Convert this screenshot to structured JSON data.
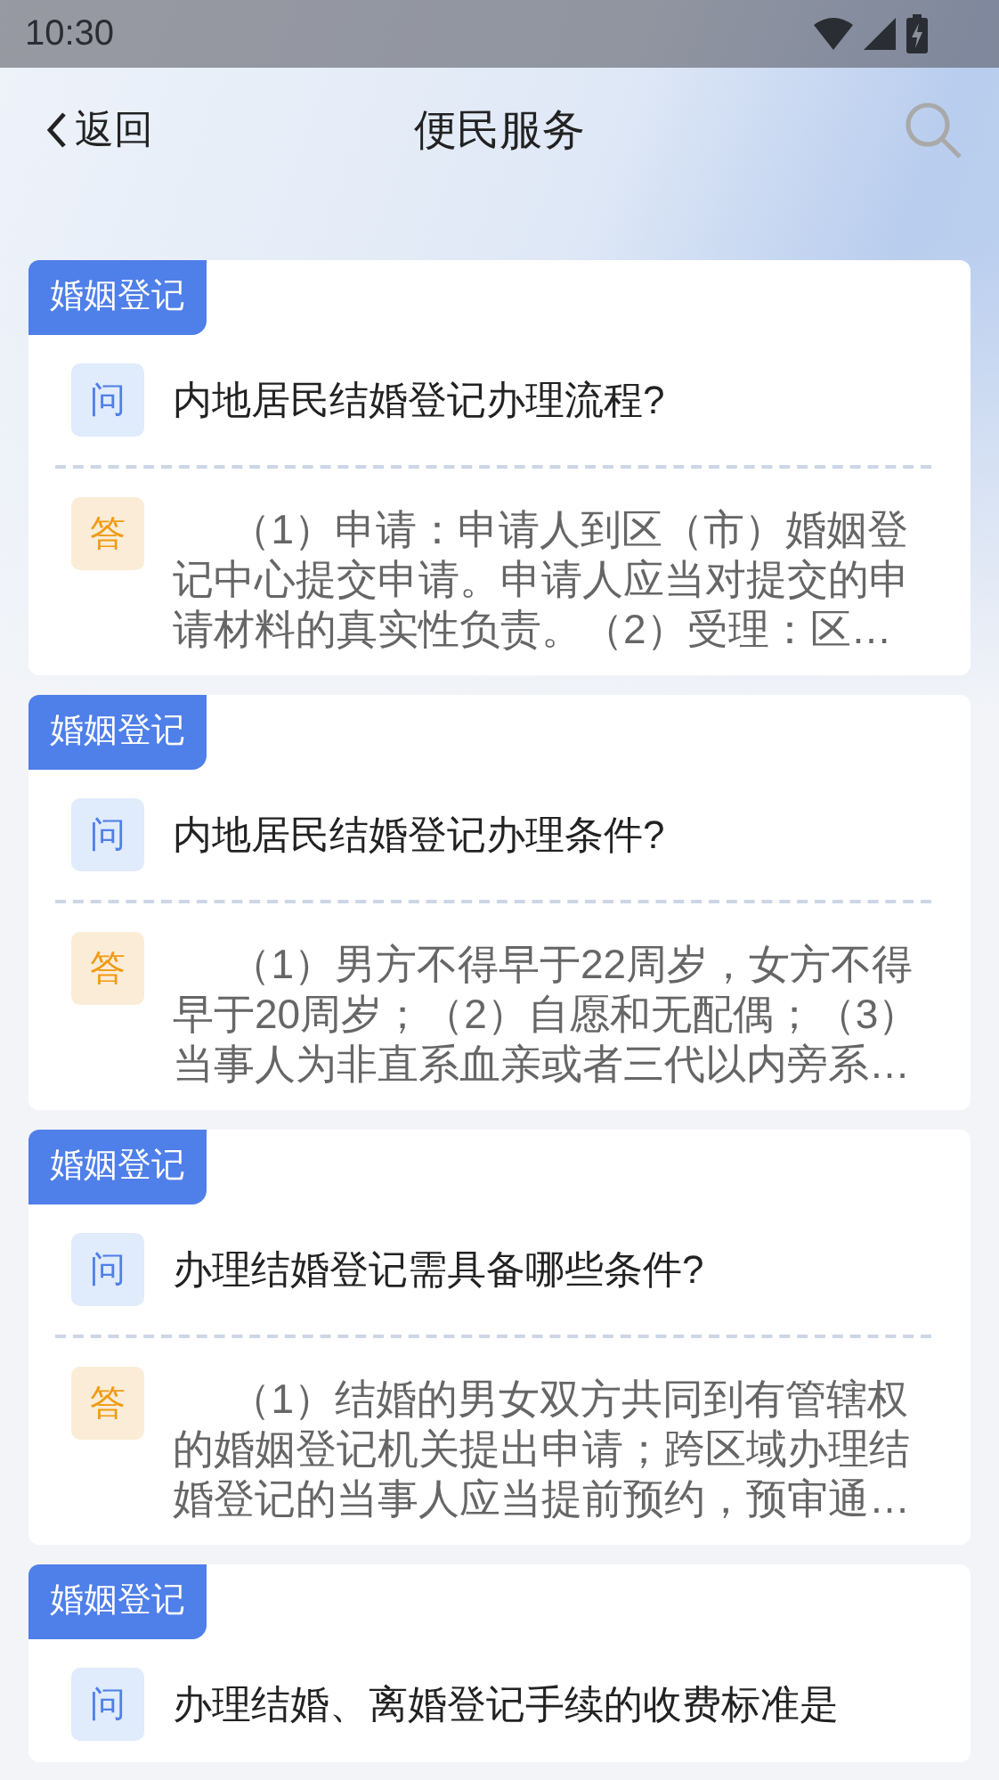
{
  "status_bar": {
    "time": "10:30"
  },
  "header": {
    "back_label": "返回",
    "title": "便民服务"
  },
  "items": [
    {
      "tag": "婚姻登记",
      "question_badge": "问",
      "question": "内地居民结婚登记办理流程?",
      "answer_badge": "答",
      "answer": "（1）申请：申请人到区（市）婚姻登记中心提交申请。申请人应当对提交的申请材料的真实性负责。（2）受理：区…"
    },
    {
      "tag": "婚姻登记",
      "question_badge": "问",
      "question": "内地居民结婚登记办理条件?",
      "answer_badge": "答",
      "answer": "（1）男方不得早于22周岁，女方不得早于20周岁；（2）自愿和无配偶；（3）当事人为非直系血亲或者三代以内旁系…"
    },
    {
      "tag": "婚姻登记",
      "question_badge": "问",
      "question": "办理结婚登记需具备哪些条件?",
      "answer_badge": "答",
      "answer": "（1）结婚的男女双方共同到有管辖权的婚姻登记机关提出申请；跨区域办理结婚登记的当事人应当提前预约，预审通…"
    },
    {
      "tag": "婚姻登记",
      "question_badge": "问",
      "question": "办理结婚、离婚登记手续的收费标准是"
    }
  ]
}
